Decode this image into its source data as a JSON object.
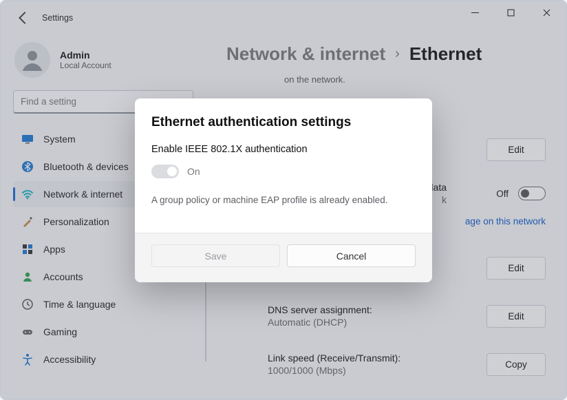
{
  "window": {
    "app_title": "Settings"
  },
  "user": {
    "name": "Admin",
    "subtitle": "Local Account"
  },
  "search": {
    "placeholder": "Find a setting"
  },
  "sidebar": {
    "items": [
      {
        "label": "System"
      },
      {
        "label": "Bluetooth & devices"
      },
      {
        "label": "Network & internet"
      },
      {
        "label": "Personalization"
      },
      {
        "label": "Apps"
      },
      {
        "label": "Accounts"
      },
      {
        "label": "Time & language"
      },
      {
        "label": "Gaming"
      },
      {
        "label": "Accessibility"
      }
    ]
  },
  "breadcrumb": {
    "root": "Network & internet",
    "leaf": "Ethernet",
    "sep": "›"
  },
  "truncated_note": "on the network.",
  "rows": {
    "auth": {
      "action": "Edit"
    },
    "metered": {
      "partial_label": "data",
      "partial_sub": "k",
      "off": "Off"
    },
    "usage_link": "age on this network",
    "ip": {
      "action": "Edit"
    },
    "dns": {
      "label": "DNS server assignment:",
      "value": "Automatic (DHCP)",
      "action": "Edit"
    },
    "link": {
      "label": "Link speed (Receive/Transmit):",
      "value": "1000/1000 (Mbps)",
      "action": "Copy"
    }
  },
  "modal": {
    "title": "Ethernet authentication settings",
    "subtitle": "Enable IEEE 802.1X authentication",
    "toggle_label": "On",
    "note": "A group policy or machine EAP profile is already enabled.",
    "save": "Save",
    "cancel": "Cancel"
  }
}
